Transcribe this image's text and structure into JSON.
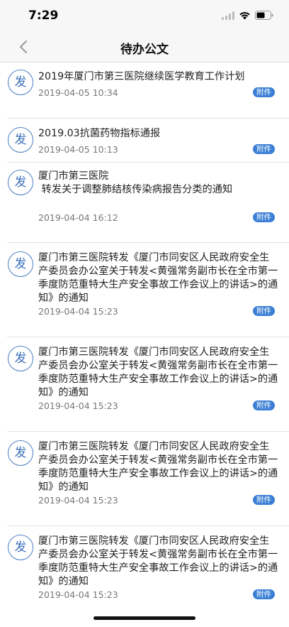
{
  "status": {
    "time": "7:29"
  },
  "nav": {
    "title": "待办公文"
  },
  "badge_label": "发",
  "attach_label": "附件",
  "items": [
    {
      "title": "2019年厦门市第三医院继续医学教育工作计划",
      "date": "2019-04-05 10:34"
    },
    {
      "title": "2019.03抗菌药物指标通报",
      "date": "2019-04-05 10:13"
    },
    {
      "title": "厦门市第三医院\n 转发关于调整肺结核传染病报告分类的通知",
      "date": "2019-04-04 16:12"
    },
    {
      "title": "厦门市第三医院转发《厦门市同安区人民政府安全生产委员会办公室关于转发<黄强常务副市长在全市第一季度防范重特大生产安全事故工作会议上的讲话>的通知》的通知",
      "date": "2019-04-04 15:23"
    },
    {
      "title": "厦门市第三医院转发《厦门市同安区人民政府安全生产委员会办公室关于转发<黄强常务副市长在全市第一季度防范重特大生产安全事故工作会议上的讲话>的通知》的通知",
      "date": "2019-04-04 15:23"
    },
    {
      "title": "厦门市第三医院转发《厦门市同安区人民政府安全生产委员会办公室关于转发<黄强常务副市长在全市第一季度防范重特大生产安全事故工作会议上的讲话>的通知》的通知",
      "date": "2019-04-04 15:23"
    },
    {
      "title": "厦门市第三医院转发《厦门市同安区人民政府安全生产委员会办公室关于转发<黄强常务副市长在全市第一季度防范重特大生产安全事故工作会议上的讲话>的通知》的通知",
      "date": "2019-04-04 15:23"
    }
  ]
}
